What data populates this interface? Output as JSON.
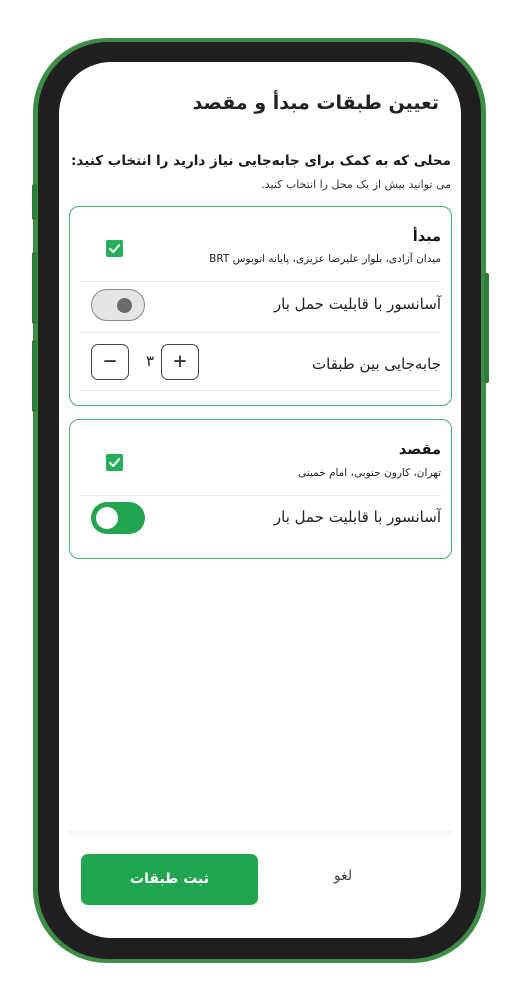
{
  "header": {
    "title": "تعیین طبقات مبدأ و مقصد",
    "subtitle": "محلی که به کمک برای جابه‌جایی نیاز دارید را انتخاب کنید:",
    "hint": "می توانید بیش از یک محل را انتخاب کنید."
  },
  "origin": {
    "title": "مبدأ",
    "address": "میدان آزادی، بلوار علیرضا عزیزی، پایانه اتوبوس BRT",
    "checked": true,
    "elevator_label": "آسانسور با قابلیت حمل بار",
    "elevator_on": false,
    "floors_label": "جابه‌جایی بین طبقات",
    "floors_value": "۳",
    "minus_label": "−",
    "plus_label": "+"
  },
  "destination": {
    "title": "مقصد",
    "address": "تهران، کارون جنوبی، امام خمینی",
    "checked": true,
    "elevator_label": "آسانسور با قابلیت حمل بار",
    "elevator_on": true
  },
  "footer": {
    "submit_label": "ثبت طبقات",
    "cancel_label": "لغو"
  },
  "colors": {
    "accent": "#22a551",
    "frame": "#3d8d46",
    "card_border": "#4caf6a"
  }
}
